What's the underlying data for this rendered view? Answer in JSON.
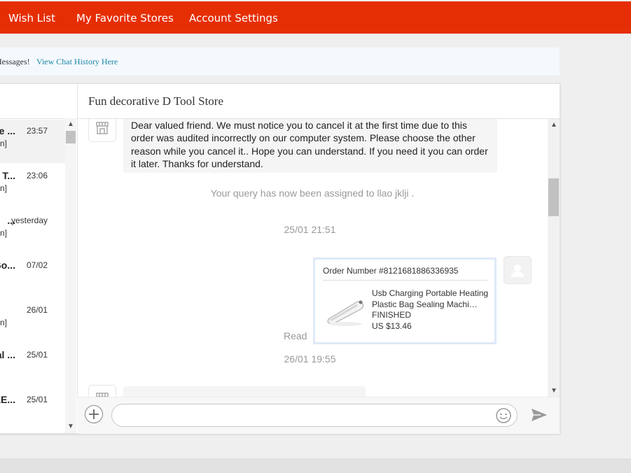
{
  "nav": {
    "items": [
      "Wish List",
      "My Favorite Stores",
      "Account Settings"
    ],
    "bg_color": "#e62e04"
  },
  "notice": {
    "text": "Messages!",
    "link": "View Chat History Here"
  },
  "conversations": [
    {
      "name": "e ...",
      "time": "23:57",
      "sub": "n]",
      "active": true
    },
    {
      "name": "g T...",
      "time": "23:06",
      "sub": "n]"
    },
    {
      "name": "...",
      "time": "yesterday",
      "sub": "n]"
    },
    {
      "name": "Go...",
      "time": "07/02",
      "sub": ""
    },
    {
      "name": "",
      "time": "26/01",
      "sub": "n]"
    },
    {
      "name": "al ...",
      "time": "25/01",
      "sub": ""
    },
    {
      "name": "LE...",
      "time": "25/01",
      "sub": ""
    }
  ],
  "chat": {
    "store_name": "Fun decorative D Tool Store",
    "seller_message": "Dear valued friend. We must notice you to cancel it at the first time due to this order was audited incorrectly on our computer system. Please choose the other reason while you cancel it.. Hope you can understand. If you need it you can order it later. Thanks for understand.",
    "system_message": "Your query has now been assigned to llao jklji .",
    "timestamp_1": "25/01 21:51",
    "read_label": "Read",
    "timestamp_2": "26/01 19:55",
    "order": {
      "number": "Order Number #8121681886336935",
      "product": "Usb Charging Portable Heating Plastic Bag Sealing Machi…",
      "status": "FINISHED",
      "price": "US $13.46"
    }
  },
  "input": {
    "placeholder": ""
  },
  "icons": [
    "store-icon",
    "user-avatar-icon",
    "plus-icon",
    "emoji-icon",
    "send-icon"
  ]
}
